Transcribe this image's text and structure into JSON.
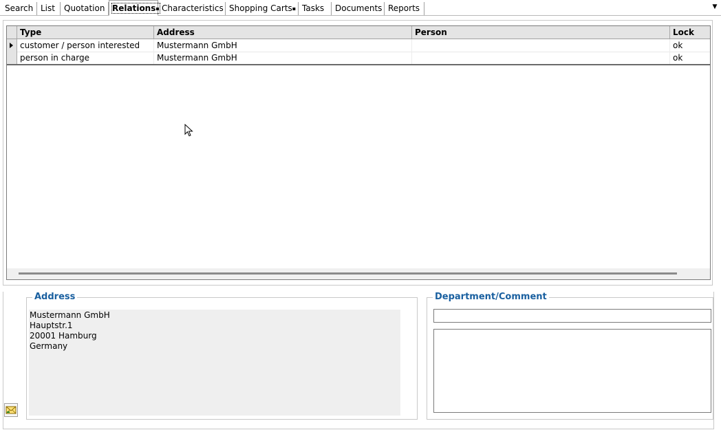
{
  "tabs": [
    {
      "label": "Search"
    },
    {
      "label": "List"
    },
    {
      "label": "Quotation"
    },
    {
      "label": "Relations",
      "marker": "▪"
    },
    {
      "label": "Characteristics"
    },
    {
      "label": "Shopping Carts",
      "marker": "▪"
    },
    {
      "label": "Tasks"
    },
    {
      "label": "Documents"
    },
    {
      "label": "Reports"
    }
  ],
  "active_tab": "Relations",
  "tab_dropdown_icon": "chevron-down-icon",
  "grid": {
    "columns": [
      "Type",
      "Address",
      "Person",
      "Lock"
    ],
    "rows": [
      {
        "type": "customer / person interested",
        "address": "Mustermann GmbH",
        "person": "",
        "lock": "ok",
        "selected": true
      },
      {
        "type": "person in charge",
        "address": "Mustermann GmbH",
        "person": "",
        "lock": "ok",
        "selected": false
      }
    ]
  },
  "address_box": {
    "title": "Address",
    "lines": [
      "Mustermann GmbH",
      "Hauptstr.1",
      "20001 Hamburg",
      "Germany"
    ]
  },
  "department_box": {
    "title": "Department/Comment",
    "department_value": "",
    "comment_value": ""
  },
  "colors": {
    "group_title": "#1a60a0",
    "header_bg": "#e4e4e4",
    "address_bg": "#efefef"
  }
}
